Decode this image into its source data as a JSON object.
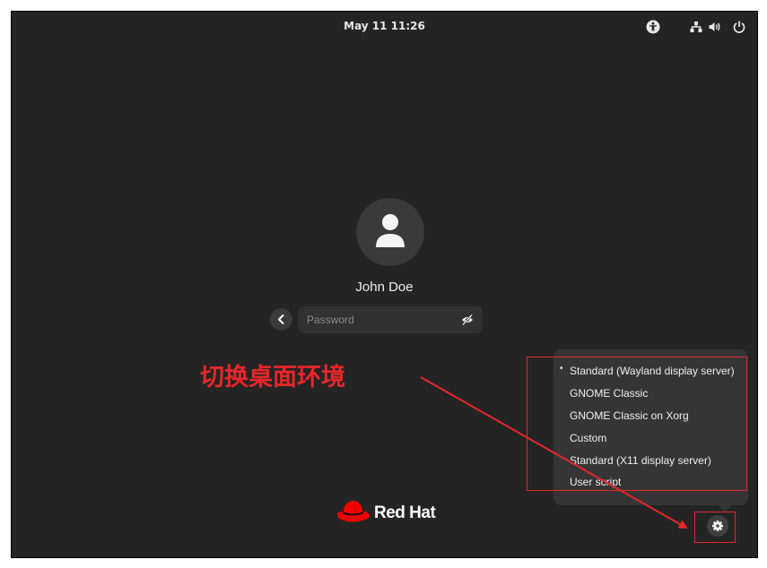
{
  "topbar": {
    "clock": "May 11  11:26",
    "icons": [
      "accessibility-icon",
      "network-icon",
      "volume-icon",
      "power-icon"
    ]
  },
  "login": {
    "username": "John Doe",
    "password_placeholder": "Password",
    "back_icon": "chevron-left-icon",
    "reveal_icon": "eye-hidden-icon"
  },
  "annotation": {
    "text": "切换桌面环境",
    "color": "#e8262a"
  },
  "session_menu": {
    "items": [
      {
        "label": "Standard (Wayland display server)",
        "selected": true,
        "marker": "•"
      },
      {
        "label": "GNOME Classic",
        "selected": false,
        "marker": ""
      },
      {
        "label": "GNOME Classic on Xorg",
        "selected": false,
        "marker": ""
      },
      {
        "label": "Custom",
        "selected": false,
        "marker": ""
      },
      {
        "label": "Standard (X11 display server)",
        "selected": false,
        "marker": ""
      },
      {
        "label": "User script",
        "selected": false,
        "marker": ""
      }
    ]
  },
  "branding": {
    "logo_text": "Red Hat",
    "logo_color": "#ee0000"
  },
  "colors": {
    "background": "#242424",
    "menu_bg": "#353535",
    "accent_red": "#e8262a"
  }
}
